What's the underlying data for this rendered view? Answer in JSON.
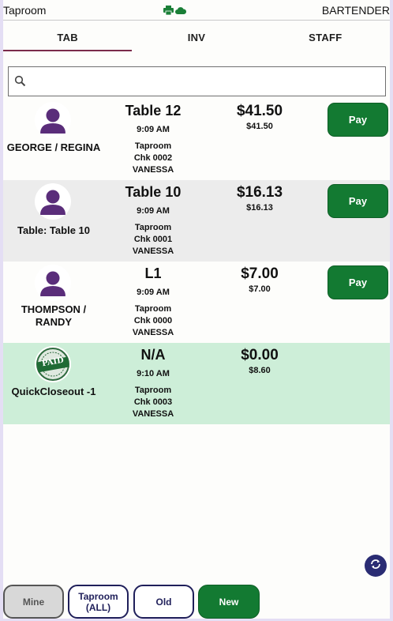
{
  "statusbar": {
    "app_title": "Taproom",
    "role": "BARTENDER",
    "icons": [
      "printer-icon",
      "cloud-icon"
    ]
  },
  "tabs": [
    {
      "label": "TAB",
      "active": true
    },
    {
      "label": "INV",
      "active": false
    },
    {
      "label": "STAFF",
      "active": false
    }
  ],
  "search": {
    "placeholder": "",
    "value": ""
  },
  "checks": [
    {
      "name": "GEORGE / REGINA",
      "table": "Table 12",
      "time": "9:09 AM",
      "area": "Taproom",
      "check": "Chk 0002",
      "server": "VANESSA",
      "amount": "$41.50",
      "subtotal": "$41.50",
      "pay_label": "Pay",
      "status": "open",
      "icon": "person-icon"
    },
    {
      "name": "Table: Table 10",
      "table": "Table 10",
      "time": "9:09 AM",
      "area": "Taproom",
      "check": "Chk 0001",
      "server": "VANESSA",
      "amount": "$16.13",
      "subtotal": "$16.13",
      "pay_label": "Pay",
      "status": "open",
      "icon": "person-icon"
    },
    {
      "name": "THOMPSON / RANDY",
      "table": "L1",
      "time": "9:09 AM",
      "area": "Taproom",
      "check": "Chk 0000",
      "server": "VANESSA",
      "amount": "$7.00",
      "subtotal": "$7.00",
      "pay_label": "Pay",
      "status": "open",
      "icon": "person-icon"
    },
    {
      "name": "QuickCloseout -1",
      "table": "N/A",
      "time": "9:10 AM",
      "area": "Taproom",
      "check": "Chk 0003",
      "server": "VANESSA",
      "amount": "$0.00",
      "subtotal": "$8.60",
      "status": "paid",
      "icon": "paid-stamp-icon",
      "stamp_text": "PAID"
    }
  ],
  "bottom_buttons": {
    "mine": "Mine",
    "taproom_line1": "Taproom",
    "taproom_line2": "(ALL)",
    "old": "Old",
    "new": "New"
  },
  "colors": {
    "accent_green": "#137a32",
    "paid_row": "#cdeed8",
    "avatar_purple": "#5a2d7a",
    "tab_underline": "#7a2b4b",
    "fab": "#2a2c73"
  }
}
